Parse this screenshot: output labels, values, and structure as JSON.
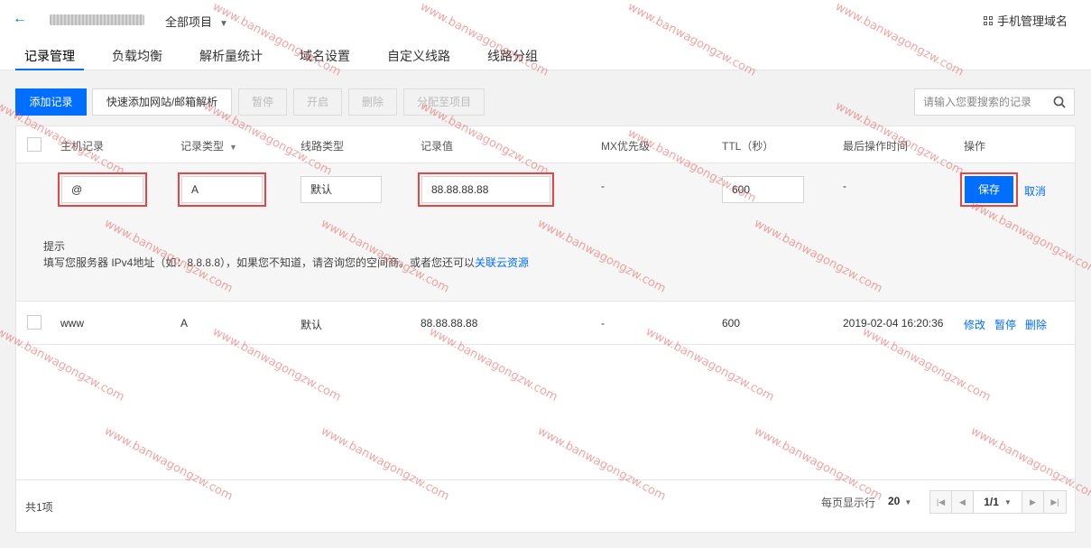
{
  "header": {
    "back_icon": "arrow-left-icon",
    "project_label": "全部项目",
    "mobile_manage_label": "手机管理域名",
    "tabs": [
      "记录管理",
      "负载均衡",
      "解析量统计",
      "域名设置",
      "自定义线路",
      "线路分组"
    ],
    "active_tab": "记录管理"
  },
  "toolbar": {
    "add_record": "添加记录",
    "quick_add": "快速添加网站/邮箱解析",
    "pause": "暂停",
    "enable": "开启",
    "delete": "删除",
    "assign_project": "分配至项目",
    "search_placeholder": "请输入您要搜索的记录"
  },
  "table": {
    "columns": [
      "主机记录",
      "记录类型",
      "线路类型",
      "记录值",
      "MX优先级",
      "TTL（秒）",
      "最后操作时间",
      "操作"
    ],
    "edit_row": {
      "host": "@",
      "type": "A",
      "line": "默认",
      "value": "88.88.88.88",
      "mx": "-",
      "ttl": "600",
      "last_op": "-",
      "save": "保存",
      "cancel": "取消"
    },
    "tip": {
      "title": "提示",
      "text": "填写您服务器 IPv4地址（如：8.8.8.8），如果您不知道，请咨询您的空间商。或者您还可以",
      "link": "关联云资源"
    },
    "rows": [
      {
        "host": "www",
        "type": "A",
        "line": "默认",
        "value": "88.88.88.88",
        "mx": "-",
        "ttl": "600",
        "last_op": "2019-02-04 16:20:36",
        "actions": [
          "修改",
          "暂停",
          "删除"
        ]
      }
    ]
  },
  "footer": {
    "total": "共1项",
    "per_page_label": "每页显示行",
    "per_page_value": "20",
    "page": "1/1"
  },
  "watermark_text": "www.banwagongzw.com",
  "colors": {
    "accent": "#006eff",
    "highlight_border": "#e54545",
    "watermark": "#e65a5a"
  }
}
